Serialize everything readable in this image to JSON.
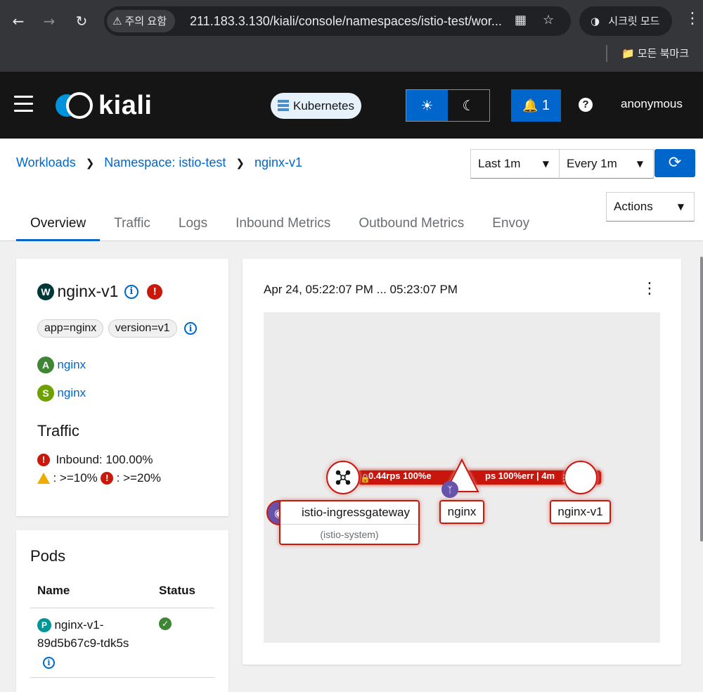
{
  "browser": {
    "warning_chip": "주의 요함",
    "url": "211.183.3.130/kiali/console/namespaces/istio-test/wor...",
    "incognito_label": "시크릿 모드",
    "bookmarks_label": "모든 북마크"
  },
  "masthead": {
    "logo_text": "kiali",
    "cluster_label": "Kubernetes",
    "notification_count": "1",
    "user": "anonymous"
  },
  "breadcrumb": {
    "items": [
      "Workloads",
      "Namespace: istio-test",
      "nginx-v1"
    ]
  },
  "controls": {
    "duration": "Last 1m",
    "refresh_interval": "Every 1m",
    "actions_label": "Actions"
  },
  "tabs": [
    "Overview",
    "Traffic",
    "Logs",
    "Inbound Metrics",
    "Outbound Metrics",
    "Envoy"
  ],
  "workload": {
    "type_badge": "W",
    "name": "nginx-v1",
    "labels": [
      "app=nginx",
      "version=v1"
    ],
    "app_badge": "A",
    "app_link": "nginx",
    "service_badge": "S",
    "service_link": "nginx",
    "traffic_title": "Traffic",
    "inbound_text": "Inbound: 100.00%",
    "legend_warn": ": >=10%",
    "legend_err": ": >=20%"
  },
  "pods": {
    "title": "Pods",
    "col_name": "Name",
    "col_status": "Status",
    "rows": [
      {
        "badge": "P",
        "name": "nginx-v1-89d5b67c9-tdk5s",
        "status": "ok"
      }
    ]
  },
  "graph": {
    "time_range": "Apr 24, 05:22:07 PM ... 05:23:07 PM",
    "edge1_label": "0.44rps 100%e",
    "edge2_label": "ps 100%err | 4m",
    "nodes": {
      "gateway": "istio-ingressgateway",
      "gateway_ns": "(istio-system)",
      "service": "nginx",
      "workload": "nginx-v1"
    }
  },
  "colors": {
    "accent": "#0066cc",
    "masthead": "#151515",
    "error": "#c9190b",
    "warning": "#f0ab00",
    "success": "#3e8635",
    "service_badge": "#6ca100",
    "app_badge": "#3e8635",
    "workload_badge": "#003737",
    "pod_badge": "#009596"
  }
}
